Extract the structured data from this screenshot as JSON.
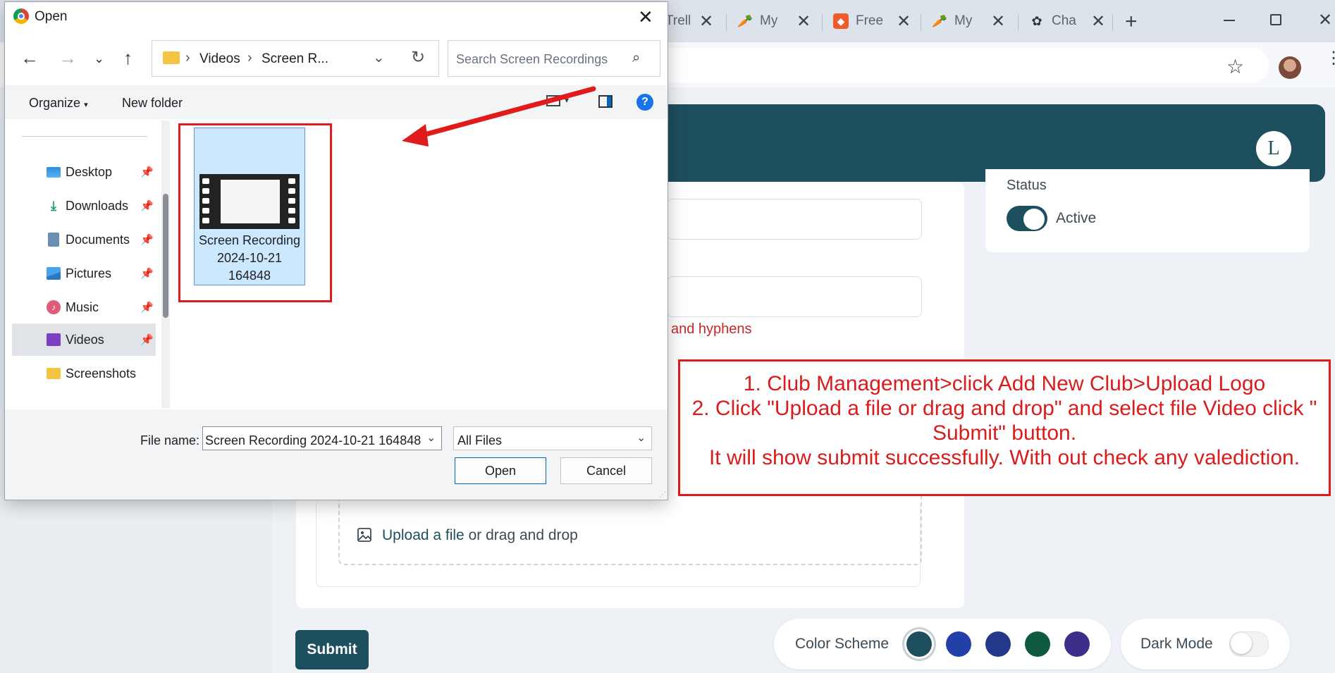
{
  "browser": {
    "tabs": [
      {
        "label": "Trell",
        "icon": "trello-icon"
      },
      {
        "label": "My",
        "icon": "carrot-icon"
      },
      {
        "label": "Free",
        "icon": "badge-icon"
      },
      {
        "label": "My",
        "icon": "carrot-icon"
      },
      {
        "label": "Cha",
        "icon": "openai-icon"
      }
    ],
    "new_tab": "+",
    "close_glyph": "✕"
  },
  "page": {
    "hint_text": "and hyphens",
    "status": {
      "label": "Status",
      "value": "Active",
      "on": true
    },
    "upload": {
      "link": "Upload a file",
      "rest": " or drag and drop"
    },
    "submit_label": "Submit",
    "color_scheme": {
      "label": "Color Scheme",
      "swatches": [
        "#1d4f5f",
        "#2240a8",
        "#24388a",
        "#0d5a3e",
        "#3b2f8a"
      ]
    },
    "dark_mode": {
      "label": "Dark Mode",
      "on": false
    }
  },
  "note": {
    "lines": [
      "1. Club Management>click Add New Club>Upload Logo",
      "2. Click \"Upload a file or drag and drop\" and select file Video click \"",
      "Submit\" button.",
      "It will show submit successfully. With out check any valediction."
    ],
    "color": "#e01b1b"
  },
  "dialog": {
    "title": "Open",
    "address": {
      "crumbs": [
        "Videos",
        "Screen R..."
      ]
    },
    "search_placeholder": "Search Screen Recordings",
    "organize_label": "Organize",
    "new_folder_label": "New folder",
    "nav_items": [
      {
        "label": "Desktop",
        "icon": "desktop-icon",
        "pinned": true
      },
      {
        "label": "Downloads",
        "icon": "download-icon",
        "pinned": true
      },
      {
        "label": "Documents",
        "icon": "documents-icon",
        "pinned": true
      },
      {
        "label": "Pictures",
        "icon": "pictures-icon",
        "pinned": true
      },
      {
        "label": "Music",
        "icon": "music-icon",
        "pinned": true
      },
      {
        "label": "Videos",
        "icon": "videos-icon",
        "pinned": true,
        "selected": true
      },
      {
        "label": "Screenshots",
        "icon": "folder-icon",
        "pinned": false
      }
    ],
    "file": {
      "line1": "Screen Recording",
      "line2": "2024-10-21",
      "line3": "164848"
    },
    "file_name_label": "File name:",
    "file_name_value": "Screen Recording 2024-10-21 164848",
    "file_type_value": "All Files",
    "open_label": "Open",
    "cancel_label": "Cancel"
  }
}
